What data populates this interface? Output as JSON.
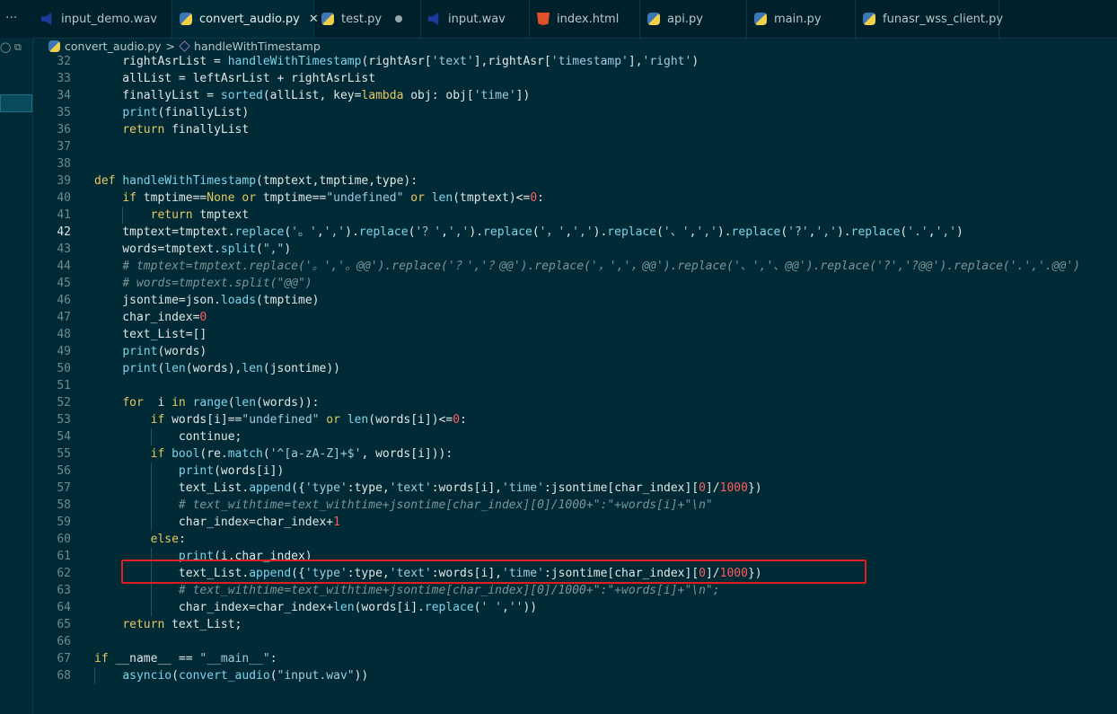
{
  "tabs": [
    {
      "label": "input_demo.wav",
      "icon": "wav-file-icon",
      "active": false
    },
    {
      "label": "convert_audio.py",
      "icon": "python-file-icon",
      "active": true
    },
    {
      "label": "test.py",
      "icon": "python-file-icon",
      "active": false,
      "modified": true
    },
    {
      "label": "input.wav",
      "icon": "wav-file-icon",
      "active": false
    },
    {
      "label": "index.html",
      "icon": "html-file-icon",
      "active": false
    },
    {
      "label": "api.py",
      "icon": "python-file-icon",
      "active": false
    },
    {
      "label": "main.py",
      "icon": "python-file-icon",
      "active": false
    },
    {
      "label": "funasr_wss_client.py",
      "icon": "python-file-icon",
      "active": false
    }
  ],
  "more_label": "···",
  "close_glyph": "✕",
  "breadcrumb": {
    "file": "convert_audio.py",
    "separator": ">",
    "symbol": "handleWithTimestamp"
  },
  "current_line": 42,
  "colors": {
    "background": "#002b36",
    "keyword": "#e6c760",
    "function": "#7fd3e8",
    "string": "#9ecbe0",
    "number": "#ff5c5c",
    "comment": "#7c9498",
    "highlight_box": "#e02020"
  },
  "lines": [
    {
      "n": "32",
      "text": "    rightAsrList = handleWithTimestamp(rightAsr['text'],rightAsr['timestamp'],'right')"
    },
    {
      "n": "33",
      "text": "    allList = leftAsrList + rightAsrList"
    },
    {
      "n": "34",
      "text": "    finallyList = sorted(allList, key=lambda obj: obj['time'])"
    },
    {
      "n": "35",
      "text": "    print(finallyList)"
    },
    {
      "n": "36",
      "text": "    return finallyList"
    },
    {
      "n": "37",
      "text": ""
    },
    {
      "n": "38",
      "text": ""
    },
    {
      "n": "39",
      "text": "def handleWithTimestamp(tmptext,tmptime,type):"
    },
    {
      "n": "40",
      "text": "    if tmptime==None or tmptime==\"undefined\" or len(tmptext)<=0:"
    },
    {
      "n": "41",
      "text": "        return tmptext"
    },
    {
      "n": "42",
      "text": "    tmptext=tmptext.replace('。',',').replace('？',',').replace('，',',').replace('、',',').replace('?',',').replace('.',',')"
    },
    {
      "n": "43",
      "text": "    words=tmptext.split(\",\")"
    },
    {
      "n": "44",
      "text": "    # tmptext=tmptext.replace('。','。@@').replace('？','？@@').replace('，','，@@').replace('、','、@@').replace('?','?@@').replace('.','.@@')"
    },
    {
      "n": "45",
      "text": "    # words=tmptext.split(\"@@\")"
    },
    {
      "n": "46",
      "text": "    jsontime=json.loads(tmptime)"
    },
    {
      "n": "47",
      "text": "    char_index=0"
    },
    {
      "n": "48",
      "text": "    text_List=[]"
    },
    {
      "n": "49",
      "text": "    print(words)"
    },
    {
      "n": "50",
      "text": "    print(len(words),len(jsontime))"
    },
    {
      "n": "51",
      "text": ""
    },
    {
      "n": "52",
      "text": "    for  i in range(len(words)):"
    },
    {
      "n": "53",
      "text": "        if words[i]==\"undefined\" or len(words[i])<=0:"
    },
    {
      "n": "54",
      "text": "            continue;"
    },
    {
      "n": "55",
      "text": "        if bool(re.match('^[a-zA-Z]+$', words[i])):"
    },
    {
      "n": "56",
      "text": "            print(words[i])"
    },
    {
      "n": "57",
      "text": "            text_List.append({'type':type,'text':words[i],'time':jsontime[char_index][0]/1000})"
    },
    {
      "n": "58",
      "text": "            # text_withtime=text_withtime+jsontime[char_index][0]/1000+\":\"+words[i]+\"\\n\""
    },
    {
      "n": "59",
      "text": "            char_index=char_index+1"
    },
    {
      "n": "60",
      "text": "        else:"
    },
    {
      "n": "61",
      "text": "            print(i,char_index)"
    },
    {
      "n": "62",
      "text": "            text_List.append({'type':type,'text':words[i],'time':jsontime[char_index][0]/1000})"
    },
    {
      "n": "63",
      "text": "            # text_withtime=text_withtime+jsontime[char_index][0]/1000+\":\"+words[i]+\"\\n\";"
    },
    {
      "n": "64",
      "text": "            char_index=char_index+len(words[i].replace(' ',''))"
    },
    {
      "n": "65",
      "text": "    return text_List;"
    },
    {
      "n": "66",
      "text": ""
    },
    {
      "n": "67",
      "text": "if __name__ == \"__main__\":"
    },
    {
      "n": "68",
      "text": "    asyncio(convert_audio(\"input.wav\"))"
    }
  ]
}
